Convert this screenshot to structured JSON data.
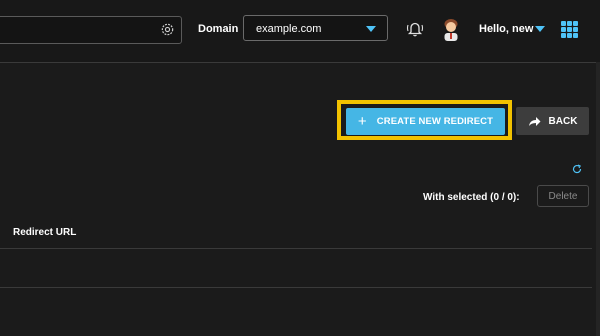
{
  "header": {
    "domain_label": "Domain",
    "domain_value": "example.com",
    "greeting": "Hello, new",
    "icons": [
      "gear-icon",
      "bell-icon",
      "avatar",
      "apps-grid-icon"
    ]
  },
  "actions": {
    "create_label": "CREATE NEW REDIRECT",
    "back_label": "BACK"
  },
  "bulk": {
    "with_selected": "With selected (0 / 0):",
    "delete_label": "Delete"
  },
  "table": {
    "columns": [
      "Redirect URL"
    ]
  },
  "colors": {
    "accent": "#4fc3f7",
    "button_primary": "#45b6e5",
    "highlight": "#f2c200",
    "background": "#1b1b1b"
  }
}
